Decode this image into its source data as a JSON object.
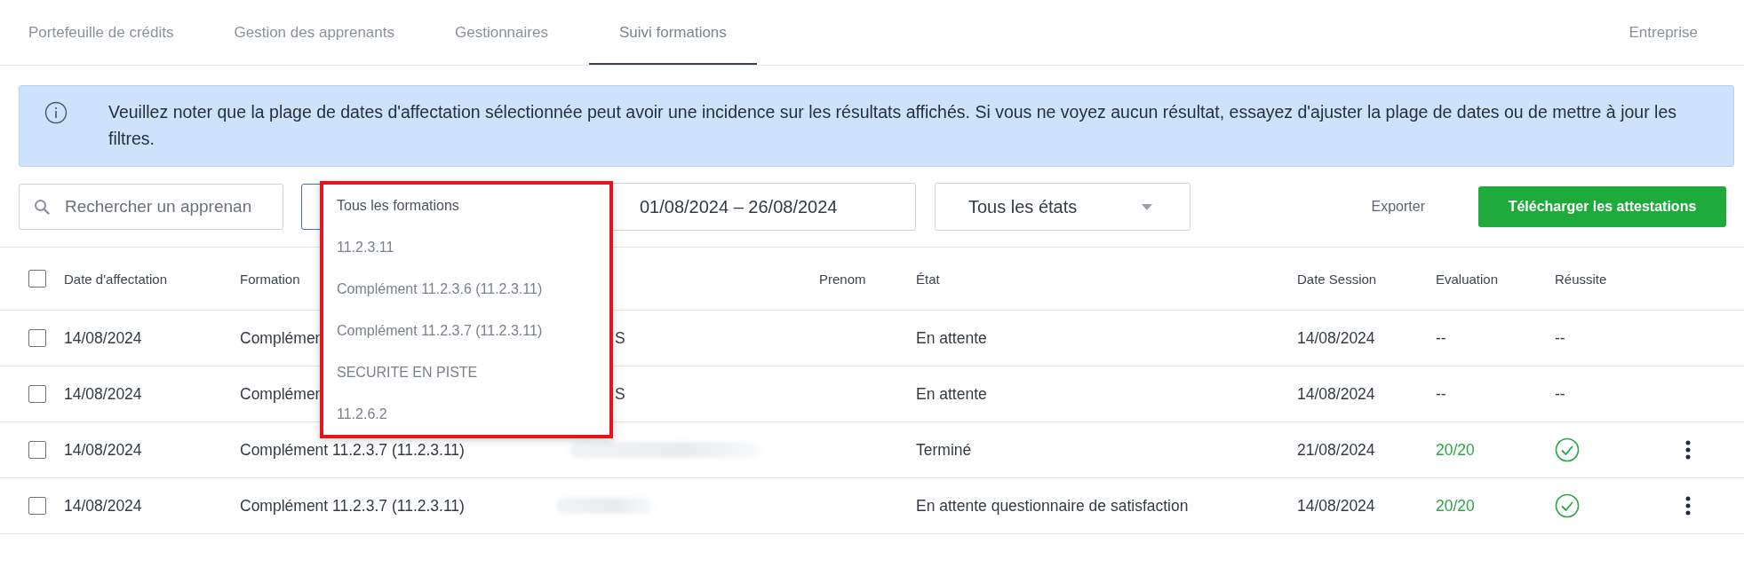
{
  "tabs": [
    {
      "label": "Portefeuille de crédits",
      "selected": false
    },
    {
      "label": "Gestion des apprenants",
      "selected": false
    },
    {
      "label": "Gestionnaires",
      "selected": false
    },
    {
      "label": "Suivi formations",
      "selected": true
    }
  ],
  "company_tab": {
    "label": "Entreprise"
  },
  "notice": {
    "text": "Veuillez noter que la plage de dates d'affectation sélectionnée peut avoir une incidence sur les résultats affichés. Si vous ne voyez aucun résultat, essayez d'ajuster la plage de dates ou de mettre à jour les filtres."
  },
  "filters": {
    "search": {
      "placeholder": "Rechercher un apprenan"
    },
    "date_range": "01/08/2024 – 26/08/2024",
    "state_select": "Tous les états",
    "export": "Exporter",
    "download_button": "Télécharger les attestations"
  },
  "formation_dropdown": {
    "highlighted": true,
    "options": [
      {
        "label": "Tous les formations",
        "selected": true
      },
      {
        "label": "11.2.3.11",
        "selected": false
      },
      {
        "label": "Complément 11.2.3.6 (11.2.3.11)",
        "selected": false
      },
      {
        "label": "Complément 11.2.3.7 (11.2.3.11)",
        "selected": false
      },
      {
        "label": "SECURITE EN PISTE",
        "selected": false
      },
      {
        "label": "11.2.6.2",
        "selected": false
      }
    ]
  },
  "table": {
    "select_all_checked": false,
    "columns": [
      "Date d'affectation",
      "Formation",
      "Prenom",
      "État",
      "Date Session",
      "Evaluation",
      "Réussite"
    ],
    "rows": [
      {
        "checked": false,
        "date": "14/08/2024",
        "formation": "Complémen",
        "nom": "S",
        "etat": "En attente",
        "date_session": "14/08/2024",
        "evaluation": "--",
        "passed": false,
        "reussite": {
          "kind": "text",
          "text": "--"
        },
        "menu": false
      },
      {
        "checked": false,
        "date": "14/08/2024",
        "formation": "Complémen",
        "nom": "S",
        "etat": "En attente",
        "date_session": "14/08/2024",
        "evaluation": "--",
        "passed": false,
        "reussite": {
          "kind": "text",
          "text": "--"
        },
        "menu": false
      },
      {
        "checked": false,
        "date": "14/08/2024",
        "formation": "Complément 11.2.3.7 (11.2.3.11)",
        "etat": "Terminé",
        "date_session": "21/08/2024",
        "evaluation": "20/20",
        "passed": true,
        "reussite": {
          "kind": "check"
        },
        "menu": true
      },
      {
        "checked": false,
        "date": "14/08/2024",
        "formation": "Complément 11.2.3.7 (11.2.3.11)",
        "etat": "En attente questionnaire de satisfaction",
        "date_session": "14/08/2024",
        "evaluation": "20/20",
        "passed": true,
        "reussite": {
          "kind": "check"
        },
        "menu": true
      }
    ]
  }
}
